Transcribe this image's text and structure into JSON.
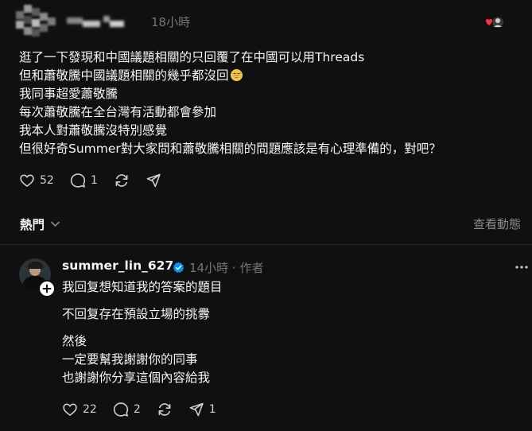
{
  "post": {
    "time": "18小時",
    "lines": [
      "逛了一下發現和中國議題相關的只回覆了在中國可以用Threads",
      "但和蕭敬騰中國議題相關的幾乎都沒回",
      "我同事超愛蕭敬騰",
      "每次蕭敬騰在全台灣有活動都會參加",
      "我本人對蕭敬騰沒特別感覺",
      "但很好奇Summer對大家問和蕭敬騰相關的問題應該是有心理準備的，對吧？"
    ],
    "emoji": "grinning-sweat-emoji",
    "likes": "52",
    "replies": "1"
  },
  "section": {
    "sort_label": "熱門",
    "view_activity": "查看動態"
  },
  "reply": {
    "username": "summer_lin_627",
    "time": "14小時",
    "separator": "·",
    "author_tag": "作者",
    "paragraphs": [
      [
        "我回复想知道我的答案的題目"
      ],
      [
        "不回复存在預設立場的挑釁"
      ],
      [
        "然後",
        "一定要幫我謝謝你的同事",
        "也謝謝你分享這個內容給我"
      ]
    ],
    "likes": "22",
    "replies": "2",
    "shares": "1"
  },
  "colors": {
    "background": "#101010",
    "text_primary": "#f3f5f7",
    "text_secondary": "#777777",
    "verified_blue": "#0095f6",
    "heart_red": "#ff3040"
  }
}
